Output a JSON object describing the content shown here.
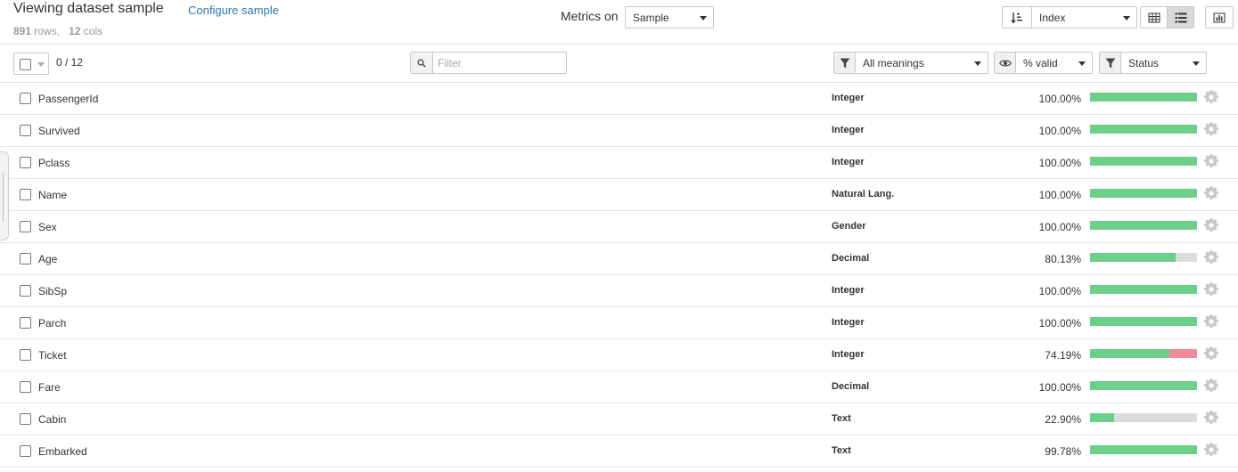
{
  "header": {
    "title": "Viewing dataset sample",
    "configure_link": "Configure sample",
    "rows_count": "891",
    "rows_label": "rows,",
    "cols_count": "12",
    "cols_label": "cols",
    "metrics_label": "Metrics on",
    "metrics_value": "Sample",
    "sort_value": "Index",
    "icons": [
      "sort-icon",
      "grid-view-icon",
      "list-view-icon",
      "chart-icon"
    ]
  },
  "toolbar": {
    "selection_count": "0 / 12",
    "filter_placeholder": "Filter",
    "meanings_value": "All meanings",
    "valid_value": "% valid",
    "status_value": "Status",
    "icons": [
      "search-icon",
      "funnel-icon",
      "eye-icon",
      "funnel-icon"
    ]
  },
  "colors": {
    "valid": "#6dd08a",
    "invalid": "#f18a99",
    "empty": "#dcdcdc",
    "link": "#2a7ab0"
  },
  "columns": [
    {
      "name": "PassengerId",
      "meaning": "Integer",
      "pct": "100.00%",
      "valid": 1.0,
      "invalid": 0.0
    },
    {
      "name": "Survived",
      "meaning": "Integer",
      "pct": "100.00%",
      "valid": 1.0,
      "invalid": 0.0
    },
    {
      "name": "Pclass",
      "meaning": "Integer",
      "pct": "100.00%",
      "valid": 1.0,
      "invalid": 0.0
    },
    {
      "name": "Name",
      "meaning": "Natural Lang.",
      "pct": "100.00%",
      "valid": 1.0,
      "invalid": 0.0
    },
    {
      "name": "Sex",
      "meaning": "Gender",
      "pct": "100.00%",
      "valid": 1.0,
      "invalid": 0.0
    },
    {
      "name": "Age",
      "meaning": "Decimal",
      "pct": "80.13%",
      "valid": 0.8013,
      "invalid": 0.0
    },
    {
      "name": "SibSp",
      "meaning": "Integer",
      "pct": "100.00%",
      "valid": 1.0,
      "invalid": 0.0
    },
    {
      "name": "Parch",
      "meaning": "Integer",
      "pct": "100.00%",
      "valid": 1.0,
      "invalid": 0.0
    },
    {
      "name": "Ticket",
      "meaning": "Integer",
      "pct": "74.19%",
      "valid": 0.7419,
      "invalid": 0.2581
    },
    {
      "name": "Fare",
      "meaning": "Decimal",
      "pct": "100.00%",
      "valid": 1.0,
      "invalid": 0.0
    },
    {
      "name": "Cabin",
      "meaning": "Text",
      "pct": "22.90%",
      "valid": 0.229,
      "invalid": 0.0
    },
    {
      "name": "Embarked",
      "meaning": "Text",
      "pct": "99.78%",
      "valid": 0.9978,
      "invalid": 0.0
    }
  ]
}
